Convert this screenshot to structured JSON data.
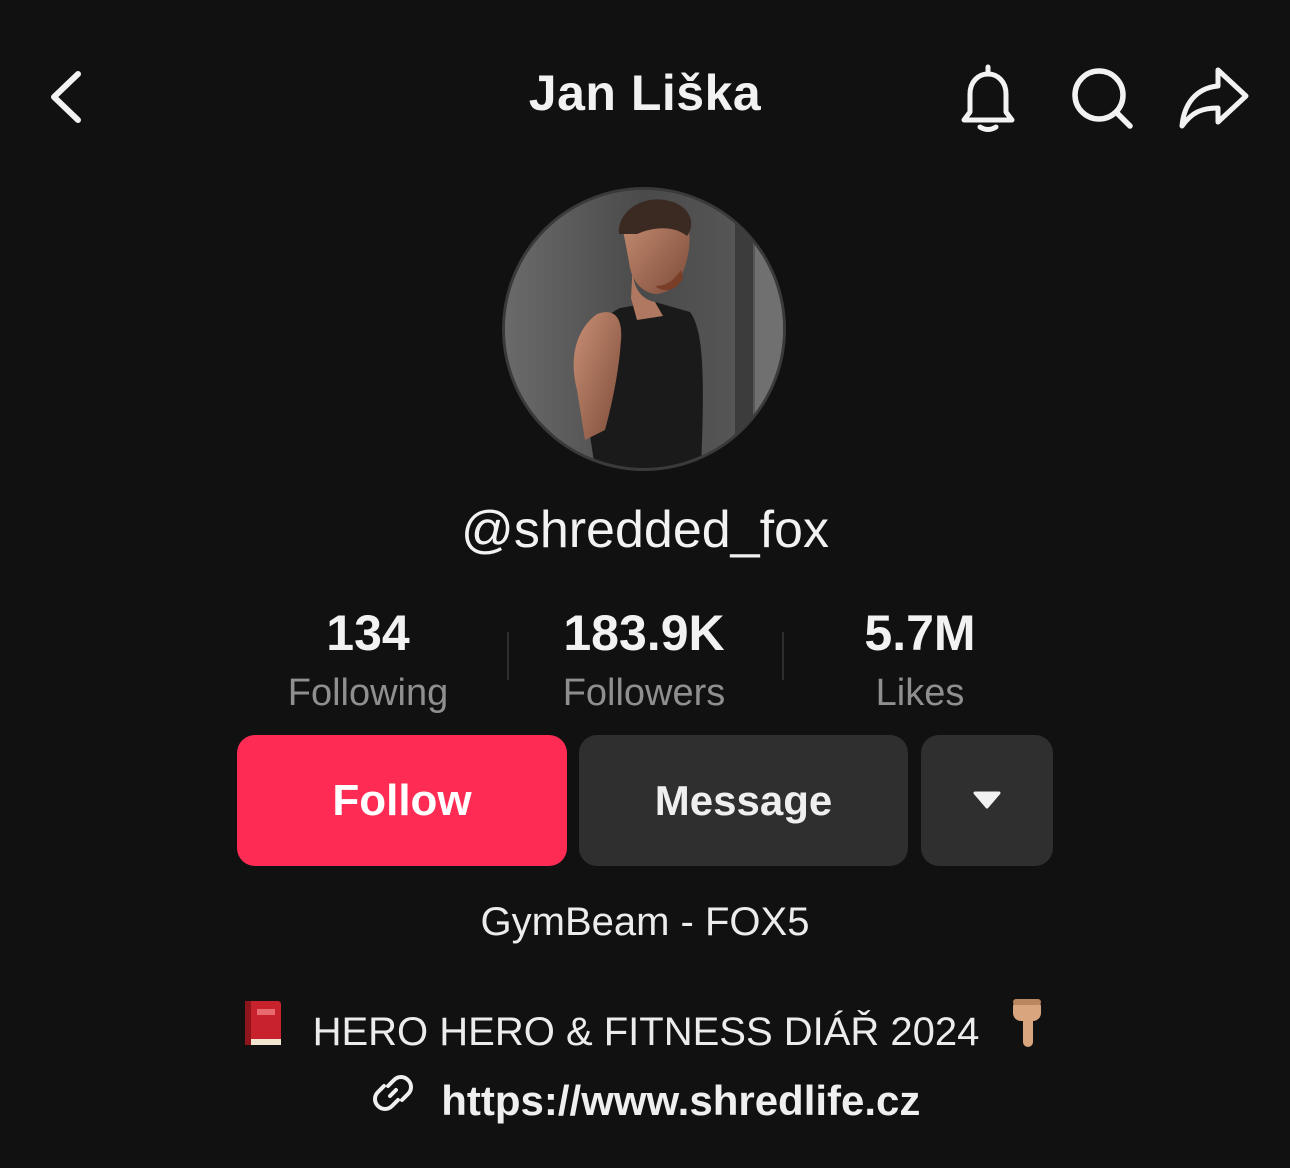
{
  "header": {
    "title": "Jan Liška",
    "back_icon": "chevron-left-icon",
    "bell_icon": "bell-icon",
    "search_icon": "search-icon",
    "share_icon": "share-icon"
  },
  "profile": {
    "handle": "@shredded_fox",
    "avatar_description": "profile photo"
  },
  "stats": [
    {
      "value": "134",
      "label": "Following"
    },
    {
      "value": "183.9K",
      "label": "Followers"
    },
    {
      "value": "5.7M",
      "label": "Likes"
    }
  ],
  "actions": {
    "follow_label": "Follow",
    "message_label": "Message",
    "more_icon": "caret-down-icon"
  },
  "bio": {
    "name_line": "GymBeam - FOX5",
    "promo_line": "HERO HERO & FITNESS DIÁŘ 2024",
    "link": "https://www.shredlife.cz"
  },
  "colors": {
    "background": "#111111",
    "follow_button": "#fe2c55",
    "secondary_button": "#2f2f2f",
    "muted_text": "#8f8f8f"
  }
}
